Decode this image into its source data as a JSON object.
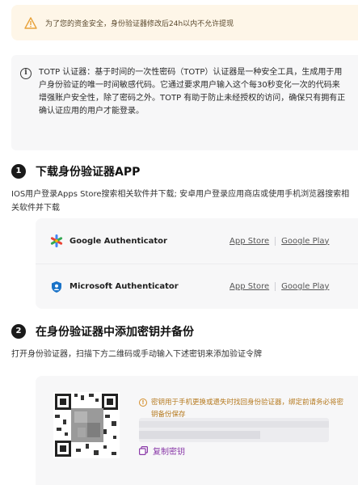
{
  "warning": {
    "text": "为了您的资金安全，身份验证器修改后24h以内不允许提现",
    "icon": "warning-triangle-icon",
    "color": "#e8a23a"
  },
  "info": {
    "icon": "info-circle-icon",
    "text": "TOTP 认证器：基于时间的一次性密码（TOTP）认证器是一种安全工具，生成用于用户身份验证的唯一时间敏感代码。它通过要求用户输入这个每30秒变化一次的代码来增强账户安全性，除了密码之外。TOTP 有助于防止未经授权的访问，确保只有拥有正确认证应用的用户才能登录。"
  },
  "step1": {
    "number": "1",
    "title": "下载身份验证器APP",
    "description": "IOS用户登录Apps Store搜索相关软件并下载; 安卓用户登录应用商店或使用手机浏览器搜索相关软件并下载",
    "apps": [
      {
        "name": "Google Authenticator",
        "icon": "google-authenticator-icon",
        "app_store": "App Store",
        "google_play": "Google Play"
      },
      {
        "name": "Microsoft Authenticator",
        "icon": "microsoft-authenticator-icon",
        "app_store": "App Store",
        "google_play": "Google Play"
      }
    ]
  },
  "step2": {
    "number": "2",
    "title": "在身份验证器中添加密钥并备份",
    "description": "打开身份验证器，扫描下方二维码或手动输入下述密钥来添加验证令牌",
    "note": "密钥用于手机更换或遗失时找回身份验证器，绑定前请务必将密钥备份保存",
    "copy_label": "复制密钥",
    "accent": "#8a3aa8"
  }
}
